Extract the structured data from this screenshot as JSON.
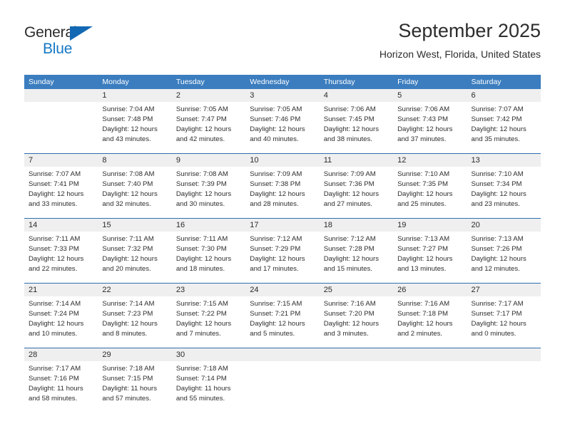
{
  "brand": {
    "name_part1": "General",
    "name_part2": "Blue",
    "accent_color": "#1577c4",
    "triangle_color": "#1268b3"
  },
  "header": {
    "title": "September 2025",
    "subtitle": "Horizon West, Florida, United States"
  },
  "calendar": {
    "header_bg": "#3b7dbf",
    "daynum_bg": "#efefef",
    "separator_color": "#2f6fb0",
    "weekdays": [
      "Sunday",
      "Monday",
      "Tuesday",
      "Wednesday",
      "Thursday",
      "Friday",
      "Saturday"
    ],
    "weeks": [
      [
        {
          "day": "",
          "lines": []
        },
        {
          "day": "1",
          "lines": [
            "Sunrise: 7:04 AM",
            "Sunset: 7:48 PM",
            "Daylight: 12 hours",
            "and 43 minutes."
          ]
        },
        {
          "day": "2",
          "lines": [
            "Sunrise: 7:05 AM",
            "Sunset: 7:47 PM",
            "Daylight: 12 hours",
            "and 42 minutes."
          ]
        },
        {
          "day": "3",
          "lines": [
            "Sunrise: 7:05 AM",
            "Sunset: 7:46 PM",
            "Daylight: 12 hours",
            "and 40 minutes."
          ]
        },
        {
          "day": "4",
          "lines": [
            "Sunrise: 7:06 AM",
            "Sunset: 7:45 PM",
            "Daylight: 12 hours",
            "and 38 minutes."
          ]
        },
        {
          "day": "5",
          "lines": [
            "Sunrise: 7:06 AM",
            "Sunset: 7:43 PM",
            "Daylight: 12 hours",
            "and 37 minutes."
          ]
        },
        {
          "day": "6",
          "lines": [
            "Sunrise: 7:07 AM",
            "Sunset: 7:42 PM",
            "Daylight: 12 hours",
            "and 35 minutes."
          ]
        }
      ],
      [
        {
          "day": "7",
          "lines": [
            "Sunrise: 7:07 AM",
            "Sunset: 7:41 PM",
            "Daylight: 12 hours",
            "and 33 minutes."
          ]
        },
        {
          "day": "8",
          "lines": [
            "Sunrise: 7:08 AM",
            "Sunset: 7:40 PM",
            "Daylight: 12 hours",
            "and 32 minutes."
          ]
        },
        {
          "day": "9",
          "lines": [
            "Sunrise: 7:08 AM",
            "Sunset: 7:39 PM",
            "Daylight: 12 hours",
            "and 30 minutes."
          ]
        },
        {
          "day": "10",
          "lines": [
            "Sunrise: 7:09 AM",
            "Sunset: 7:38 PM",
            "Daylight: 12 hours",
            "and 28 minutes."
          ]
        },
        {
          "day": "11",
          "lines": [
            "Sunrise: 7:09 AM",
            "Sunset: 7:36 PM",
            "Daylight: 12 hours",
            "and 27 minutes."
          ]
        },
        {
          "day": "12",
          "lines": [
            "Sunrise: 7:10 AM",
            "Sunset: 7:35 PM",
            "Daylight: 12 hours",
            "and 25 minutes."
          ]
        },
        {
          "day": "13",
          "lines": [
            "Sunrise: 7:10 AM",
            "Sunset: 7:34 PM",
            "Daylight: 12 hours",
            "and 23 minutes."
          ]
        }
      ],
      [
        {
          "day": "14",
          "lines": [
            "Sunrise: 7:11 AM",
            "Sunset: 7:33 PM",
            "Daylight: 12 hours",
            "and 22 minutes."
          ]
        },
        {
          "day": "15",
          "lines": [
            "Sunrise: 7:11 AM",
            "Sunset: 7:32 PM",
            "Daylight: 12 hours",
            "and 20 minutes."
          ]
        },
        {
          "day": "16",
          "lines": [
            "Sunrise: 7:11 AM",
            "Sunset: 7:30 PM",
            "Daylight: 12 hours",
            "and 18 minutes."
          ]
        },
        {
          "day": "17",
          "lines": [
            "Sunrise: 7:12 AM",
            "Sunset: 7:29 PM",
            "Daylight: 12 hours",
            "and 17 minutes."
          ]
        },
        {
          "day": "18",
          "lines": [
            "Sunrise: 7:12 AM",
            "Sunset: 7:28 PM",
            "Daylight: 12 hours",
            "and 15 minutes."
          ]
        },
        {
          "day": "19",
          "lines": [
            "Sunrise: 7:13 AM",
            "Sunset: 7:27 PM",
            "Daylight: 12 hours",
            "and 13 minutes."
          ]
        },
        {
          "day": "20",
          "lines": [
            "Sunrise: 7:13 AM",
            "Sunset: 7:26 PM",
            "Daylight: 12 hours",
            "and 12 minutes."
          ]
        }
      ],
      [
        {
          "day": "21",
          "lines": [
            "Sunrise: 7:14 AM",
            "Sunset: 7:24 PM",
            "Daylight: 12 hours",
            "and 10 minutes."
          ]
        },
        {
          "day": "22",
          "lines": [
            "Sunrise: 7:14 AM",
            "Sunset: 7:23 PM",
            "Daylight: 12 hours",
            "and 8 minutes."
          ]
        },
        {
          "day": "23",
          "lines": [
            "Sunrise: 7:15 AM",
            "Sunset: 7:22 PM",
            "Daylight: 12 hours",
            "and 7 minutes."
          ]
        },
        {
          "day": "24",
          "lines": [
            "Sunrise: 7:15 AM",
            "Sunset: 7:21 PM",
            "Daylight: 12 hours",
            "and 5 minutes."
          ]
        },
        {
          "day": "25",
          "lines": [
            "Sunrise: 7:16 AM",
            "Sunset: 7:20 PM",
            "Daylight: 12 hours",
            "and 3 minutes."
          ]
        },
        {
          "day": "26",
          "lines": [
            "Sunrise: 7:16 AM",
            "Sunset: 7:18 PM",
            "Daylight: 12 hours",
            "and 2 minutes."
          ]
        },
        {
          "day": "27",
          "lines": [
            "Sunrise: 7:17 AM",
            "Sunset: 7:17 PM",
            "Daylight: 12 hours",
            "and 0 minutes."
          ]
        }
      ],
      [
        {
          "day": "28",
          "lines": [
            "Sunrise: 7:17 AM",
            "Sunset: 7:16 PM",
            "Daylight: 11 hours",
            "and 58 minutes."
          ]
        },
        {
          "day": "29",
          "lines": [
            "Sunrise: 7:18 AM",
            "Sunset: 7:15 PM",
            "Daylight: 11 hours",
            "and 57 minutes."
          ]
        },
        {
          "day": "30",
          "lines": [
            "Sunrise: 7:18 AM",
            "Sunset: 7:14 PM",
            "Daylight: 11 hours",
            "and 55 minutes."
          ]
        },
        {
          "day": "",
          "lines": []
        },
        {
          "day": "",
          "lines": []
        },
        {
          "day": "",
          "lines": []
        },
        {
          "day": "",
          "lines": []
        }
      ]
    ]
  }
}
